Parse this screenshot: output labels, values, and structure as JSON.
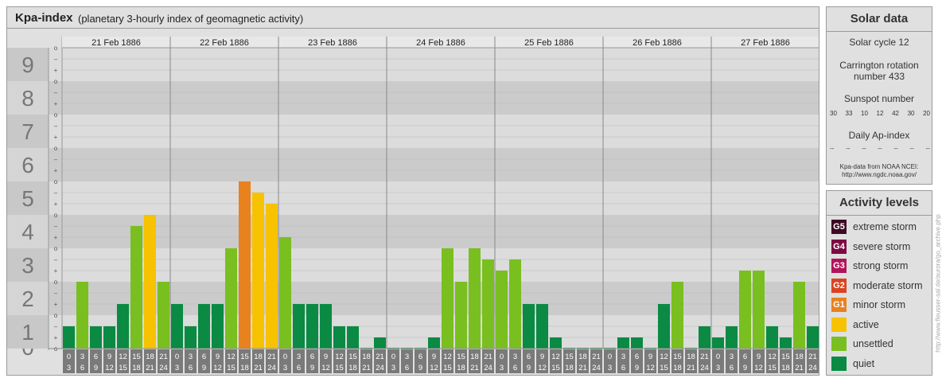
{
  "main": {
    "title": "Kpa-index",
    "subtitle": "(planetary 3-hourly index of geomagnetic activity)"
  },
  "chart_data": {
    "type": "bar",
    "ylim": [
      0,
      9
    ],
    "y_tick_labels": [
      "0",
      "1",
      "2",
      "3",
      "4",
      "5",
      "6",
      "7",
      "8",
      "9"
    ],
    "sub_tick_labels": [
      "o",
      "+",
      "–"
    ],
    "days": [
      "21 Feb 1886",
      "22 Feb 1886",
      "23 Feb 1886",
      "24 Feb 1886",
      "25 Feb 1886",
      "26 Feb 1886",
      "27 Feb 1886"
    ],
    "interval_starts": [
      "0",
      "3",
      "6",
      "9",
      "12",
      "15",
      "18",
      "21"
    ],
    "interval_ends": [
      "3",
      "6",
      "9",
      "12",
      "15",
      "18",
      "21",
      "24"
    ],
    "values": [
      [
        0.667,
        2.0,
        0.667,
        0.667,
        1.333,
        3.667,
        4.0,
        2.0
      ],
      [
        1.333,
        0.667,
        1.333,
        1.333,
        3.0,
        5.0,
        4.667,
        4.333
      ],
      [
        3.333,
        1.333,
        1.333,
        1.333,
        0.667,
        0.667,
        0.0,
        0.333
      ],
      [
        0.0,
        0.0,
        0.0,
        0.333,
        3.0,
        2.0,
        3.0,
        2.667
      ],
      [
        2.333,
        2.667,
        1.333,
        1.333,
        0.333,
        0.0,
        0.0,
        0.0
      ],
      [
        0.0,
        0.333,
        0.333,
        0.0,
        1.333,
        2.0,
        0.0,
        0.667
      ],
      [
        0.333,
        0.667,
        2.333,
        2.333,
        0.667,
        0.333,
        2.0,
        0.667
      ]
    ],
    "level_colors": {
      "quiet": "#0a8a43",
      "unsettled": "#79bf20",
      "active": "#f7c200",
      "G1": "#e8821f",
      "G2": "#d94420",
      "G3": "#b0155a",
      "G4": "#7d0a42",
      "G5": "#3d0a22"
    },
    "band_colors": [
      "#cbcbcb",
      "#dcdcdc"
    ],
    "grid": true
  },
  "solar": {
    "title": "Solar data",
    "cycle": "Solar cycle 12",
    "carrington_line1": "Carrington rotation",
    "carrington_line2": "number 433",
    "sunspot_label": "Sunspot number",
    "sunspot_values": [
      "30",
      "33",
      "10",
      "12",
      "42",
      "30",
      "20"
    ],
    "ap_label": "Daily Ap-index",
    "ap_values": [
      "--",
      "--",
      "--",
      "--",
      "--",
      "--",
      "--"
    ],
    "source_line1": "Kpa-data from NOAA NCEI:",
    "source_line2": "http://www.ngdc.noaa.gov/"
  },
  "activity": {
    "title": "Activity levels",
    "levels": [
      {
        "badge": "G5",
        "label": "extreme storm",
        "color": "#3d0a22"
      },
      {
        "badge": "G4",
        "label": "severe storm",
        "color": "#7d0a42"
      },
      {
        "badge": "G3",
        "label": "strong storm",
        "color": "#b0155a"
      },
      {
        "badge": "G2",
        "label": "moderate storm",
        "color": "#d94420"
      },
      {
        "badge": "G1",
        "label": "minor storm",
        "color": "#e8821f"
      },
      {
        "badge": "",
        "label": "active",
        "color": "#f7c200"
      },
      {
        "badge": "",
        "label": "unsettled",
        "color": "#79bf20"
      },
      {
        "badge": "",
        "label": "quiet",
        "color": "#0a8a43"
      }
    ]
  },
  "credit": "http://www.fleusser-sal.de/aurora/go_archive.php"
}
